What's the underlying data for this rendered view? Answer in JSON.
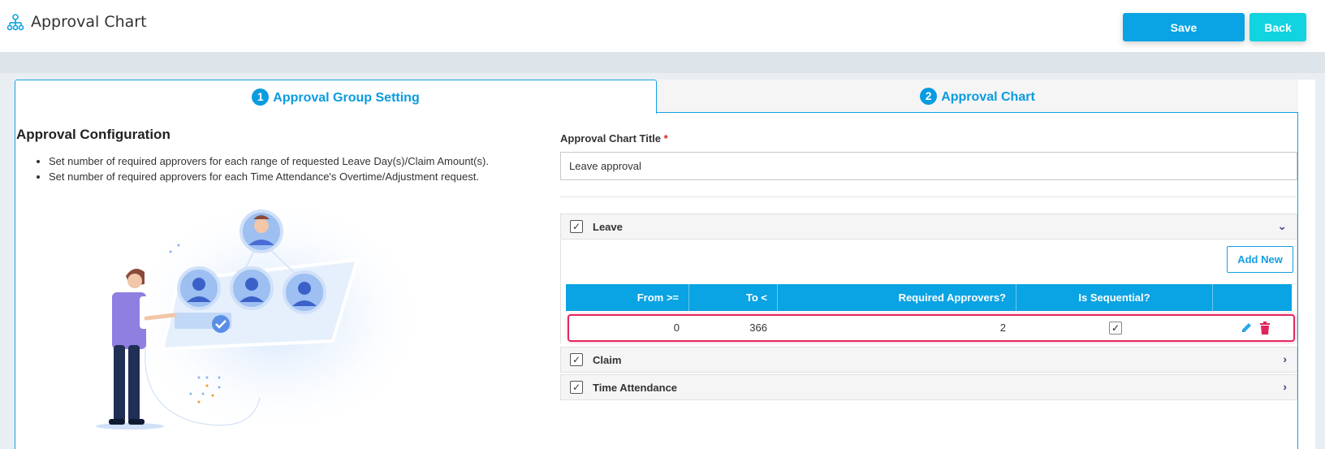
{
  "header": {
    "title": "Approval Chart",
    "save_label": "Save",
    "back_label": "Back"
  },
  "tabs": [
    {
      "number": "1",
      "label": "Approval Group Setting"
    },
    {
      "number": "2",
      "label": "Approval Chart"
    }
  ],
  "config": {
    "title": "Approval Configuration",
    "bullets": [
      "Set number of required approvers for each range of requested Leave Day(s)/Claim Amount(s).",
      "Set number of required approvers for each Time Attendance's Overtime/Adjustment request."
    ]
  },
  "form": {
    "title_label": "Approval Chart Title",
    "required_mark": "*",
    "title_value": "Leave approval"
  },
  "sections": {
    "leave": {
      "label": "Leave",
      "checked": "✓"
    },
    "claim": {
      "label": "Claim",
      "checked": "✓"
    },
    "time_attendance": {
      "label": "Time Attendance",
      "checked": "✓"
    }
  },
  "table": {
    "add_new_label": "Add New",
    "headers": [
      "From >=",
      "To <",
      "Required Approvers?",
      "Is Sequential?"
    ],
    "rows": [
      {
        "from": "0",
        "to": "366",
        "required": "2",
        "sequential": "✓"
      }
    ]
  },
  "colors": {
    "accent": "#0aa3e3",
    "back": "#12d3e0",
    "highlight": "#e2295f",
    "delete": "#e0245e"
  },
  "icons": {
    "header": "org-chart-icon",
    "edit": "pencil-icon",
    "delete": "trash-icon",
    "chevron_down": "chevron-down-icon",
    "chevron_right": "chevron-right-icon"
  }
}
